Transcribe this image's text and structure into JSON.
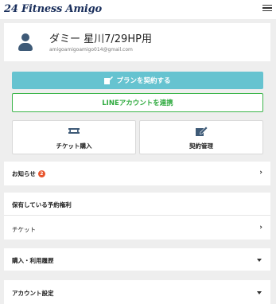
{
  "header": {
    "logo": "24 Fitness Amigo"
  },
  "profile": {
    "name": "ダミー 星川7/29HP用",
    "email": "amigoamigoamigo014@gmail.com"
  },
  "actions": {
    "plan_button": "プランを契約する",
    "line_button": "LINEアカウントを連携"
  },
  "tiles": {
    "ticket": "チケット購入",
    "contract": "契約管理"
  },
  "menu": {
    "news": "お知らせ",
    "news_badge": "2",
    "reservation_header": "保有している予約権利",
    "ticket": "チケット",
    "purchase": "購入・利用履歴",
    "account": "アカウント設定"
  },
  "colors": {
    "plan_button_bg": "#66c3d0",
    "line_accent": "#3cb54a",
    "logo": "#1a2f5c",
    "badge": "#e8542c"
  }
}
